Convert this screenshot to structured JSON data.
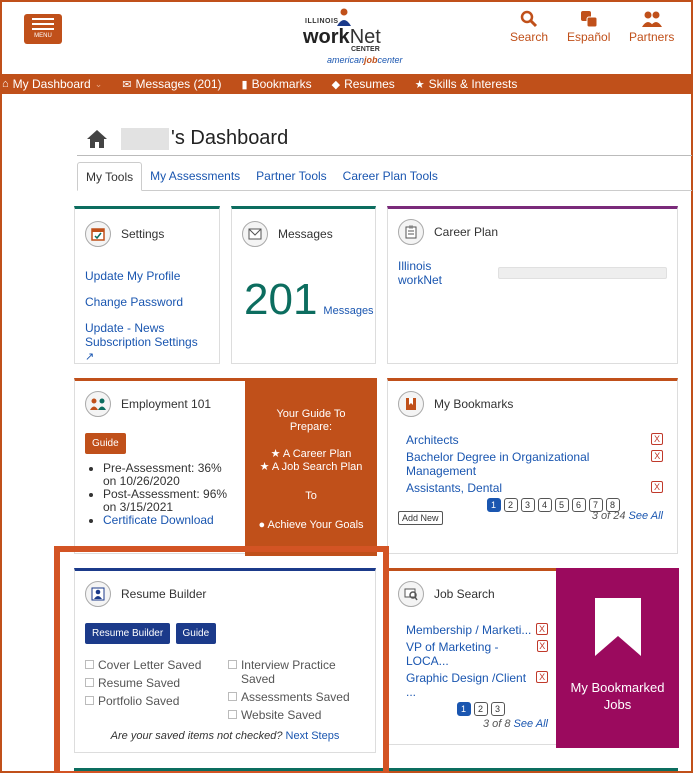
{
  "header": {
    "menu_label": "MENU",
    "logo": {
      "illinois": "ILLINOIS",
      "work": "work",
      "net": "Net",
      "center": "CENTER",
      "american": "american",
      "job": "job",
      "center2": "center"
    },
    "search_label": "Search",
    "espanol_label": "Español",
    "partners_label": "Partners"
  },
  "nav": {
    "dashboard": "My Dashboard",
    "messages": "Messages (201)",
    "bookmarks": "Bookmarks",
    "resumes": "Resumes",
    "skills": "Skills & Interests"
  },
  "page": {
    "title_suffix": "'s Dashboard",
    "tabs": [
      "My Tools",
      "My Assessments",
      "Partner Tools",
      "Career Plan Tools"
    ]
  },
  "settings": {
    "title": "Settings",
    "links": [
      "Update My Profile",
      "Change Password",
      "Update - News",
      "Subscription Settings"
    ]
  },
  "messages": {
    "title": "Messages",
    "count": "201",
    "label": "Messages"
  },
  "career_plan": {
    "title": "Career Plan",
    "item": "Illinois workNet"
  },
  "employment": {
    "title": "Employment 101",
    "guide": "Guide",
    "bullets": [
      "Pre-Assessment: 36% on 10/26/2020",
      "Post-Assessment: 96% on 3/15/2021"
    ],
    "cert_link": "Certificate Download",
    "promo": {
      "line1": "Your Guide To",
      "line2": "Prepare:",
      "item1": "★ A Career Plan",
      "item2": "★ A Job Search Plan",
      "to": "To",
      "goal": "Achieve Your Goals"
    }
  },
  "bookmarks": {
    "title": "My Bookmarks",
    "items": [
      "Architects",
      "Bachelor Degree in Organizational Management",
      "Assistants, Dental"
    ],
    "pages": [
      "1",
      "2",
      "3",
      "4",
      "5",
      "6",
      "7",
      "8"
    ],
    "add_new": "Add New",
    "count_text": "3 of 24",
    "see_all": "See All"
  },
  "resume": {
    "title": "Resume Builder",
    "btn_builder": "Resume Builder",
    "btn_guide": "Guide",
    "checks_left": [
      "Cover Letter Saved",
      "Resume Saved",
      "Portfolio Saved"
    ],
    "checks_right": [
      "Interview Practice Saved",
      "Assessments Saved",
      "Website Saved"
    ],
    "footer_q": "Are your saved items not checked?",
    "footer_link": "Next Steps"
  },
  "job_search": {
    "title": "Job Search",
    "items": [
      "Membership / Marketi...",
      "VP of Marketing - LOCA...",
      "Graphic Design /Client ..."
    ],
    "pages": [
      "1",
      "2",
      "3"
    ],
    "count_text": "3 of 8",
    "see_all": "See All",
    "promo": "My Bookmarked Jobs"
  },
  "colors": {
    "accent": "#c0501a",
    "teal": "#0c6d5f",
    "purple": "#9b0a5e",
    "navy": "#1b3a8a"
  }
}
